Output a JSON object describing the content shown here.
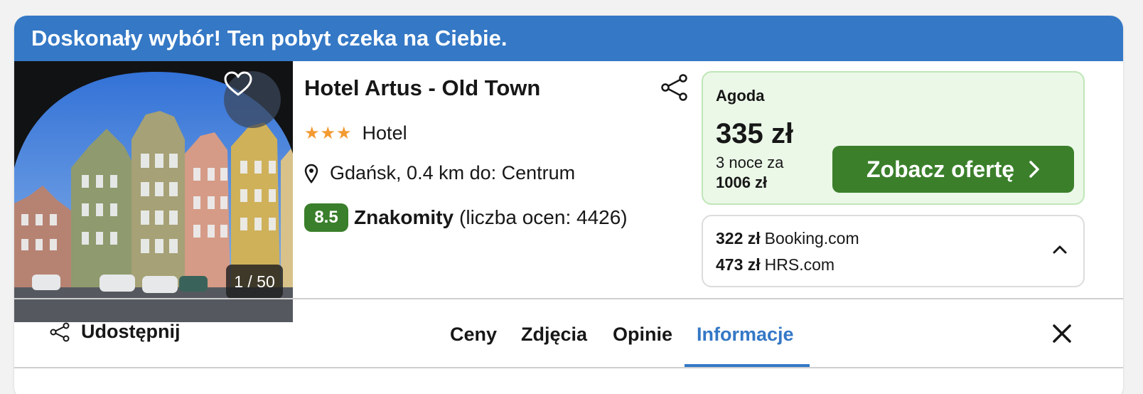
{
  "banner": {
    "text": "Doskonały wybór! Ten pobyt czeka na Ciebie."
  },
  "photo": {
    "counter": "1 / 50"
  },
  "hotel": {
    "name": "Hotel Artus - Old Town",
    "stars": "★★★",
    "star_count": 3,
    "type": "Hotel",
    "location": "Gdańsk, 0.4 km do: Centrum",
    "rating": {
      "score": "8.5",
      "label": "Znakomity",
      "count": "(liczba ocen: 4426)"
    }
  },
  "offer": {
    "provider": "Agoda",
    "price": "335 zł",
    "nights_text": "3 noce za",
    "total": "1006 zł",
    "cta_label": "Zobacz ofertę"
  },
  "other_offers": [
    {
      "price": "322 zł",
      "provider": "Booking.com"
    },
    {
      "price": "473 zł",
      "provider": "HRS.com"
    }
  ],
  "tabs": {
    "share_label": "Udostępnij",
    "items": [
      "Ceny",
      "Zdjęcia",
      "Opinie",
      "Informacje"
    ],
    "active": "Informacje"
  },
  "icons": [
    "heart-icon",
    "share-icon",
    "pin-icon",
    "chevron-right-icon",
    "chevron-up-icon",
    "close-icon"
  ],
  "colors": {
    "accent": "#3478c6",
    "green": "#3b7f2b",
    "offer_bg": "#ebf8e8",
    "star": "#f39a32"
  }
}
